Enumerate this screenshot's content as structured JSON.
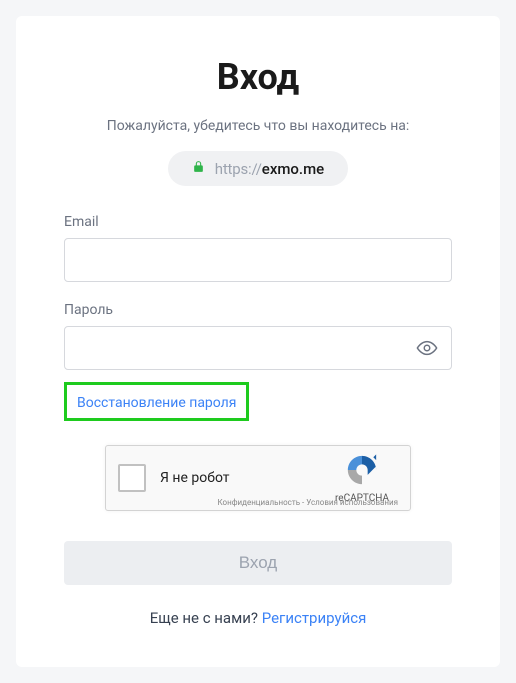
{
  "title": "Вход",
  "subtitle": "Пожалуйста, убедитесь что вы находитесь на:",
  "url": {
    "prefix": "https://",
    "domain": "exmo.me"
  },
  "form": {
    "email_label": "Email",
    "password_label": "Пароль",
    "forgot_password_label": "Восстановление пароля"
  },
  "recaptcha": {
    "not_robot": "Я не робот",
    "brand": "reCAPTCHA",
    "terms": "Конфиденциальность - Условия использования"
  },
  "submit_label": "Вход",
  "footer": {
    "text": "Еще не с нами? ",
    "link": "Регистрируйся"
  }
}
